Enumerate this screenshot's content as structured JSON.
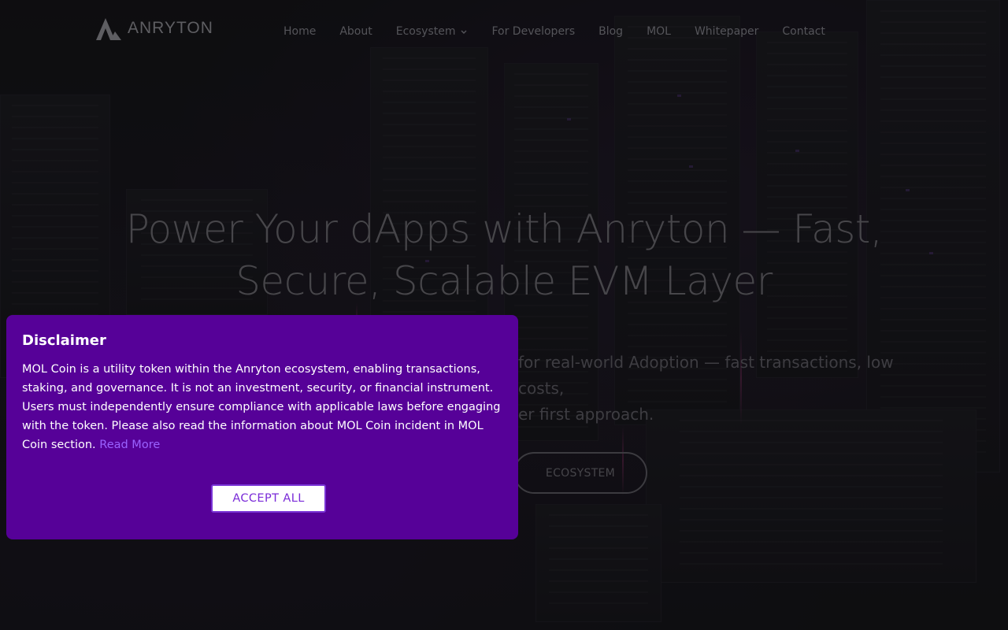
{
  "brand": {
    "name": "ANRYTON"
  },
  "nav": {
    "items": [
      {
        "label": "Home"
      },
      {
        "label": "About"
      },
      {
        "label": "Ecosystem",
        "has_dropdown": true
      },
      {
        "label": "For Developers"
      },
      {
        "label": "Blog"
      },
      {
        "label": "MOL"
      },
      {
        "label": "Whitepaper"
      },
      {
        "label": "Contact"
      }
    ]
  },
  "hero": {
    "title_line1": "Power Your dApps with Anryton — Fast,",
    "title_line2": "Secure, Scalable EVM Layer",
    "subtitle_line1": "for real-world Adoption — fast transactions, low costs,",
    "subtitle_line2": "er first approach.",
    "ecosystem_button": "ECOSYSTEM"
  },
  "disclaimer": {
    "title": "Disclaimer",
    "body": "MOL Coin is a utility token within the Anryton ecosystem, enabling transactions, staking, and governance. It is not an investment, security, or financial instrument. Users must independently ensure compliance with applicable laws before engaging with the token. Please also read the information about MOL Coin incident in MOL Coin section. ",
    "read_more": "Read More",
    "accept_label": "ACCEPT ALL"
  },
  "colors": {
    "modal_bg": "#560198",
    "link": "#9a62ff",
    "accept_text": "#7a2bd8",
    "page_bg": "#121113"
  },
  "icons": {
    "logo": "anryton-triangle-logo",
    "dropdown": "chevron-down-icon"
  }
}
